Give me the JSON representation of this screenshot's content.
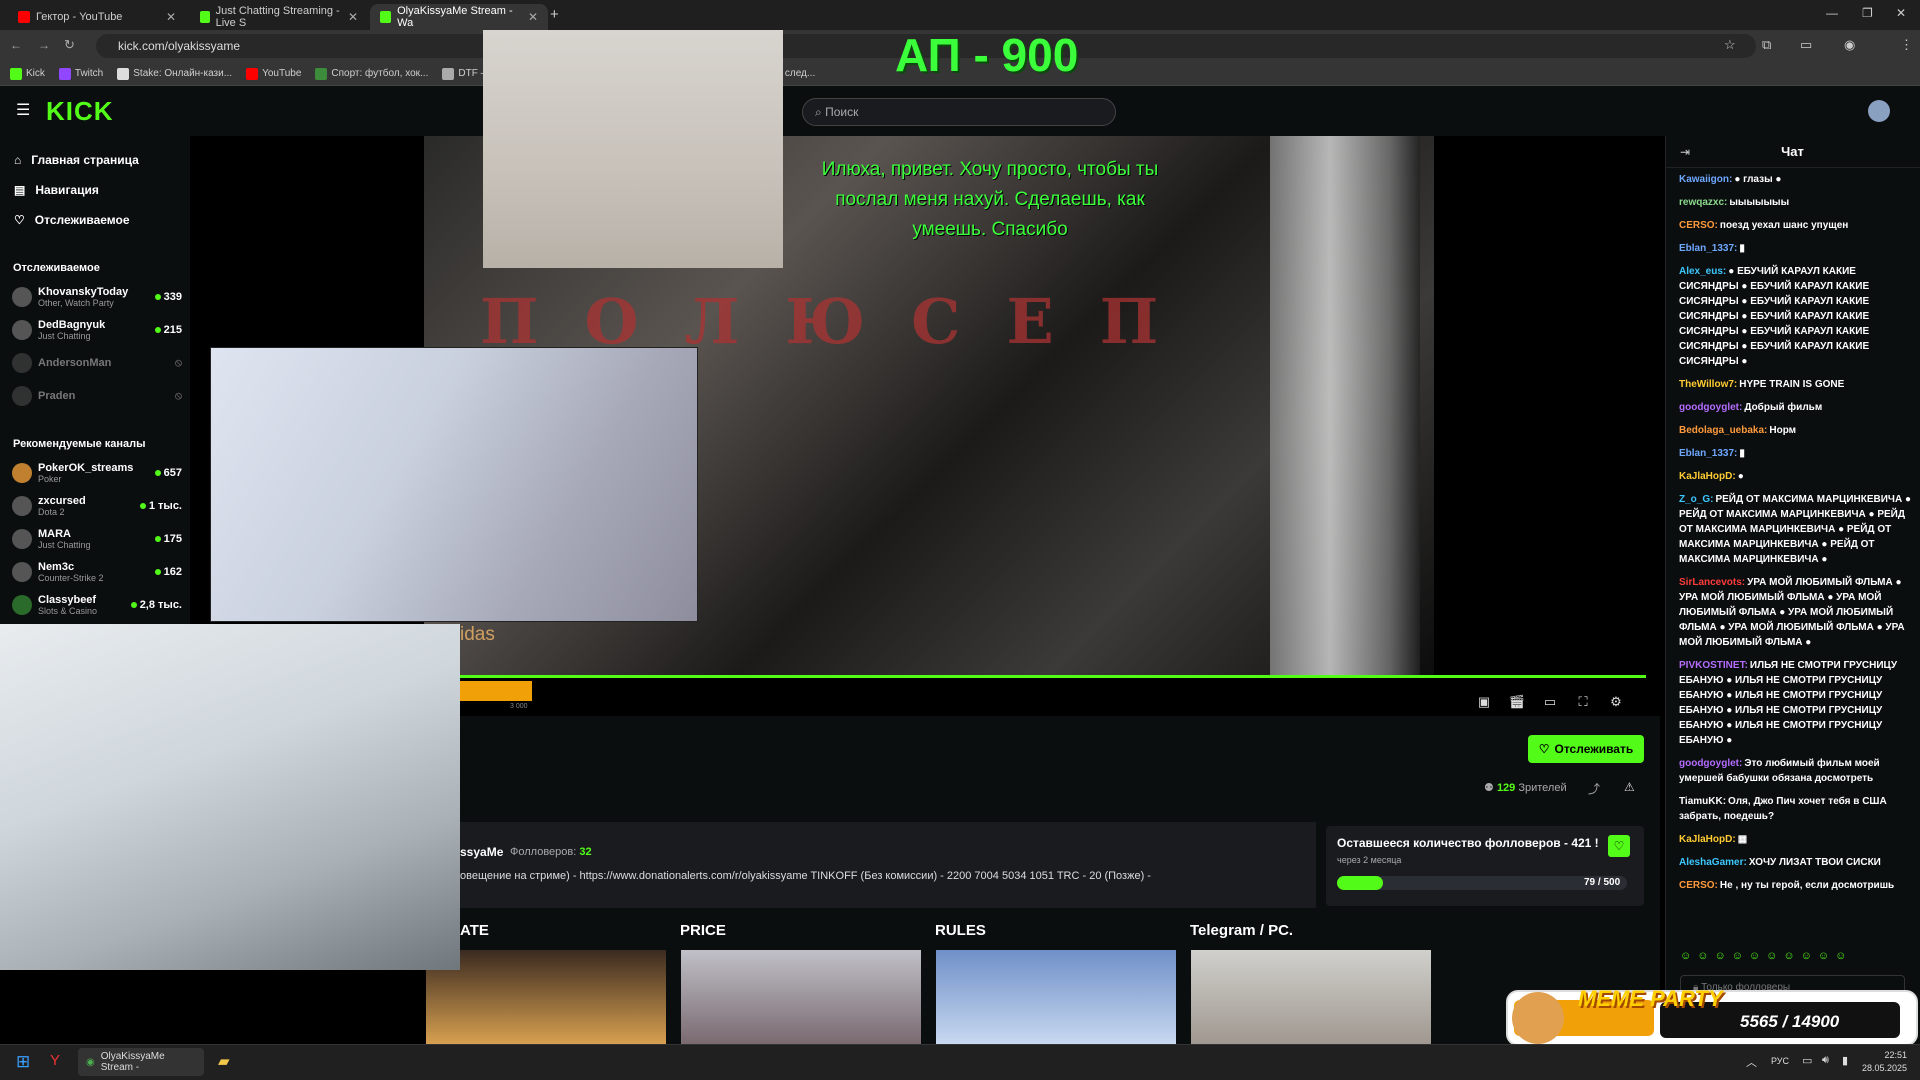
{
  "browser": {
    "tabs": [
      {
        "title": "Гектор - YouTube",
        "color": "#ff0000"
      },
      {
        "title": "Just Chatting Streaming - Live S",
        "color": "#53fc18"
      },
      {
        "title": "OlyaKissyaMe Stream - Wa",
        "color": "#53fc18"
      }
    ],
    "new_tab": "+",
    "url": "kick.com/olyakissyame",
    "bookmarks": [
      "Kick",
      "Twitch",
      "Stake: Онлайн-кази...",
      "YouTube",
      "Спорт: футбол, хок...",
      "DTF — игры, ки"
    ],
    "bookmarks_tail": "след..."
  },
  "kick": {
    "logo": "KICK",
    "search_placeholder": "Поиск",
    "nav": [
      "Главная страница",
      "Навигация",
      "Отслеживаемое"
    ],
    "followed_heading": "Отслеживаемое",
    "followed": [
      {
        "name": "KhovanskyToday",
        "category": "Other, Watch Party",
        "viewers": "339",
        "live": true
      },
      {
        "name": "DedBagnyuk",
        "category": "Just Chatting",
        "viewers": "215",
        "live": true
      },
      {
        "name": "AndersonMan",
        "category": "",
        "viewers": "",
        "live": false
      },
      {
        "name": "Praden",
        "category": "",
        "viewers": "",
        "live": false
      }
    ],
    "recommended_heading": "Рекомендуемые каналы",
    "recommended": [
      {
        "name": "PokerOK_streams",
        "category": "Poker",
        "viewers": "657"
      },
      {
        "name": "zxcursed",
        "category": "Dota 2",
        "viewers": "1 тыс."
      },
      {
        "name": "MARA",
        "category": "Just Chatting",
        "viewers": "175"
      },
      {
        "name": "Nem3c",
        "category": "Counter-Strike 2",
        "viewers": "162"
      },
      {
        "name": "Classybeef",
        "category": "Slots & Casino",
        "viewers": "2,8 тыс."
      }
    ]
  },
  "stream": {
    "overlay_title": "АП - 900",
    "donation_text": "Илюха, привет. Хочу просто, чтобы ты послал меня нахуй. Сделаешь, как умеешь. Спасибо",
    "film_title": "ПОЛЮСЕП",
    "ticker_text": "idas",
    "goal_bar_label": "3 000",
    "follow_button": "Отслеживать",
    "viewers_count": "129",
    "viewers_label": "Зрителей",
    "channel_name": "ssyaMe",
    "followers_label": "Фолловеров:",
    "followers_count": "32",
    "description": "овещение на стриме) - https://www.donationalerts.com/r/olyakissyame TINKOFF (Без комиссии) - 2200 7004 5034 1051 TRC - 20 (Позже) -",
    "goal": {
      "title": "Оставшееся количество фолловеров - 421 !",
      "subtitle": "через 2 месяца",
      "current": 79,
      "target": 500,
      "label": "79 / 500"
    },
    "panels": [
      "ATE",
      "PRICE",
      "RULES",
      "Telegram / PC."
    ]
  },
  "chat": {
    "title": "Чат",
    "messages": [
      {
        "user": "Kawaiigon:",
        "color": "#6fa8ff",
        "text": "● глазы ●"
      },
      {
        "user": "rewqazxc:",
        "color": "#8cd98c",
        "text": "ыыыыыыы"
      },
      {
        "user": "CERSO:",
        "color": "#ff9a3c",
        "text": "поезд уехал шанс упущен"
      },
      {
        "user": "Eblan_1337:",
        "color": "#6fa8ff",
        "text": "▮"
      },
      {
        "user": "Alex_eus:",
        "color": "#3cc8ff",
        "text": "● ЕБУЧИЙ КАРАУЛ КАКИЕ СИСЯНДРЫ ● ЕБУЧИЙ КАРАУЛ КАКИЕ СИСЯНДРЫ ● ЕБУЧИЙ КАРАУЛ КАКИЕ СИСЯНДРЫ ● ЕБУЧИЙ КАРАУЛ КАКИЕ СИСЯНДРЫ ● ЕБУЧИЙ КАРАУЛ КАКИЕ СИСЯНДРЫ ● ЕБУЧИЙ КАРАУЛ КАКИЕ СИСЯНДРЫ ●"
      },
      {
        "user": "TheWillow7:",
        "color": "#ffcc33",
        "text": "HYPE TRAIN IS GONE"
      },
      {
        "user": "goodgoyglet:",
        "color": "#b46cff",
        "text": "Добрый фильм"
      },
      {
        "user": "Bedolaga_uebaka:",
        "color": "#ff9a3c",
        "text": "Норм"
      },
      {
        "user": "Eblan_1337:",
        "color": "#6fa8ff",
        "text": "▮"
      },
      {
        "user": "KaJlaHopD:",
        "color": "#ffcc33",
        "text": "●"
      },
      {
        "user": "Z_o_G:",
        "color": "#3cc8ff",
        "text": "РЕЙД ОТ МАКСИМА МАРЦИНКЕВИЧА ● РЕЙД ОТ МАКСИМА МАРЦИНКЕВИЧА ● РЕЙД ОТ МАКСИМА МАРЦИНКЕВИЧА ● РЕЙД ОТ МАКСИМА МАРЦИНКЕВИЧА ● РЕЙД ОТ МАКСИМА МАРЦИНКЕВИЧА ●"
      },
      {
        "user": "SirLancevots:",
        "color": "#ff3c3c",
        "text": "УРА МОЙ ЛЮБИМЫЙ ФЛЬМА ● УРА МОЙ ЛЮБИМЫЙ ФЛЬМА ● УРА МОЙ ЛЮБИМЫЙ ФЛЬМА ● УРА МОЙ ЛЮБИМЫЙ ФЛЬМА ● УРА МОЙ ЛЮБИМЫЙ ФЛЬМА ● УРА МОЙ ЛЮБИМЫЙ ФЛЬМА ●"
      },
      {
        "user": "PIVKOSTINET:",
        "color": "#b46cff",
        "text": "ИЛЬЯ НЕ СМОТРИ ГРУСНИЦУ ЕБАНУЮ ● ИЛЬЯ НЕ СМОТРИ ГРУСНИЦУ ЕБАНУЮ ● ИЛЬЯ НЕ СМОТРИ ГРУСНИЦУ ЕБАНУЮ ● ИЛЬЯ НЕ СМОТРИ ГРУСНИЦУ ЕБАНУЮ ● ИЛЬЯ НЕ СМОТРИ ГРУСНИЦУ ЕБАНУЮ ●"
      },
      {
        "user": "goodgoyglet:",
        "color": "#b46cff",
        "text": "Это любимый фильм моей умершей бабушки обязана досмотреть"
      },
      {
        "user": "TiamuKK:",
        "color": "#ffffff",
        "text": "Оля, Джо Пич хочет тебя в США забрать, поедешь?"
      },
      {
        "user": "KaJlaHopD:",
        "color": "#ffcc33",
        "text": "▦"
      },
      {
        "user": "AleshaGamer:",
        "color": "#3cc8ff",
        "text": "ХОЧУ ЛИЗАТ ТВОИ СИСКИ"
      },
      {
        "user": "CERSO:",
        "color": "#ff9a3c",
        "text": "Не , ну ты герой, если досмотришь"
      }
    ],
    "input_placeholder": "Только фолловеры"
  },
  "meme_widget": {
    "title": "MEME PARTY",
    "count": "5565 / 14900"
  },
  "taskbar": {
    "app_label": "OlyaKissyaMe Stream -",
    "lang": "РУС",
    "time": "22:51",
    "date": "28.05.2025"
  },
  "colors": {
    "kick_green": "#53fc18",
    "bg": "#0b0e0f",
    "panel": "#191b1f"
  }
}
